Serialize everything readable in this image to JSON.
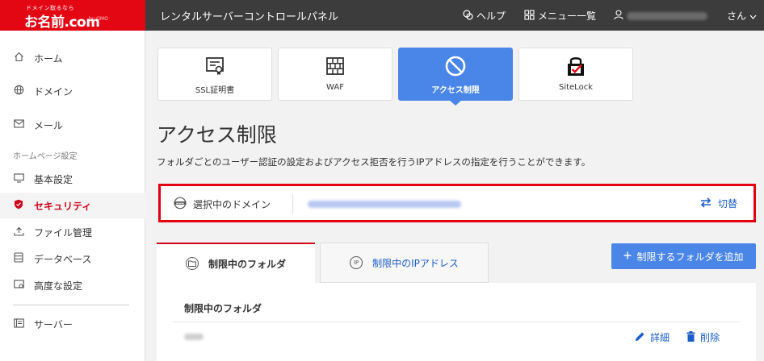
{
  "brand": {
    "tagline": "ドメイン取るなら",
    "name": "お名前.com",
    "by": "by GMO"
  },
  "header": {
    "title": "レンタルサーバーコントロールパネル",
    "help": "ヘルプ",
    "menu": "メニュー一覧",
    "user_suffix": "さん"
  },
  "sidebar": {
    "items": [
      {
        "label": "ホーム",
        "icon": "home-icon"
      },
      {
        "label": "ドメイン",
        "icon": "globe-icon"
      },
      {
        "label": "メール",
        "icon": "mail-icon"
      },
      {
        "label": "基本設定",
        "icon": "monitor-icon"
      },
      {
        "label": "セキュリティ",
        "icon": "shield-icon"
      },
      {
        "label": "ファイル管理",
        "icon": "upload-icon"
      },
      {
        "label": "データベース",
        "icon": "database-icon"
      },
      {
        "label": "高度な設定",
        "icon": "settings-window-icon"
      },
      {
        "label": "サーバー",
        "icon": "server-icon"
      }
    ],
    "section_label": "ホームページ設定",
    "active": "セキュリティ"
  },
  "tiles": [
    {
      "label": "SSL証明書",
      "icon": "certificate-icon"
    },
    {
      "label": "WAF",
      "icon": "firewall-icon"
    },
    {
      "label": "アクセス制限",
      "icon": "prohibited-icon"
    },
    {
      "label": "SiteLock",
      "icon": "lock-check-icon"
    }
  ],
  "page": {
    "title": "アクセス制限",
    "description": "フォルダごとのユーザー認証の設定およびアクセス拒否を行うIPアドレスの指定を行うことができます。"
  },
  "domain_select": {
    "label": "選択中のドメイン",
    "switch_label": "切替"
  },
  "tabs": [
    {
      "label": "制限中のフォルダ",
      "icon_text": "",
      "active": true
    },
    {
      "label": "制限中のIPアドレス",
      "icon_text": "IP",
      "active": false
    }
  ],
  "add_button": "制限するフォルダを追加",
  "panel": {
    "heading": "制限中のフォルダ",
    "edit": "詳細",
    "delete": "削除"
  },
  "colors": {
    "brand_red": "#e30613",
    "accent_blue": "#4a86e8",
    "link_blue": "#1a5dc9",
    "highlight_red": "#e00010"
  }
}
